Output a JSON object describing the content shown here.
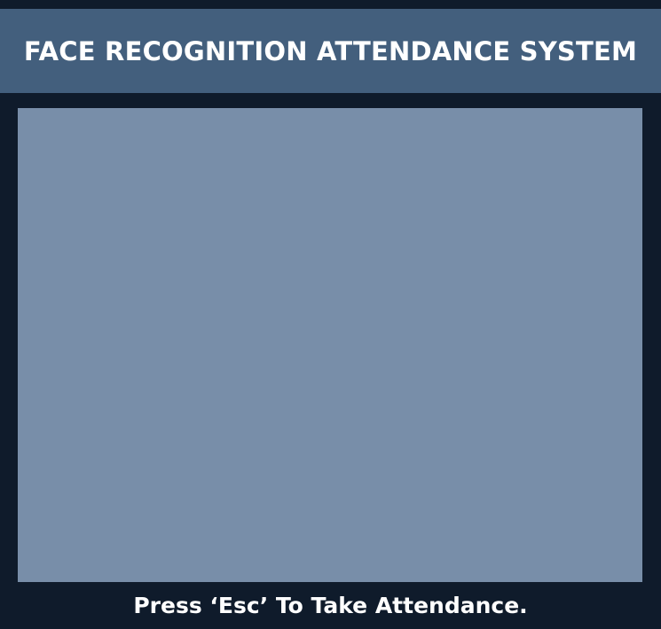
{
  "header": {
    "title": "FACE RECOGNITION ATTENDANCE SYSTEM"
  },
  "footer": {
    "instruction": "Press ‘Esc’ To Take Attendance."
  },
  "colors": {
    "background": "#0f1b2b",
    "header_bg": "#435f7d",
    "camera_panel_bg": "#788ea9",
    "text": "#ffffff"
  }
}
